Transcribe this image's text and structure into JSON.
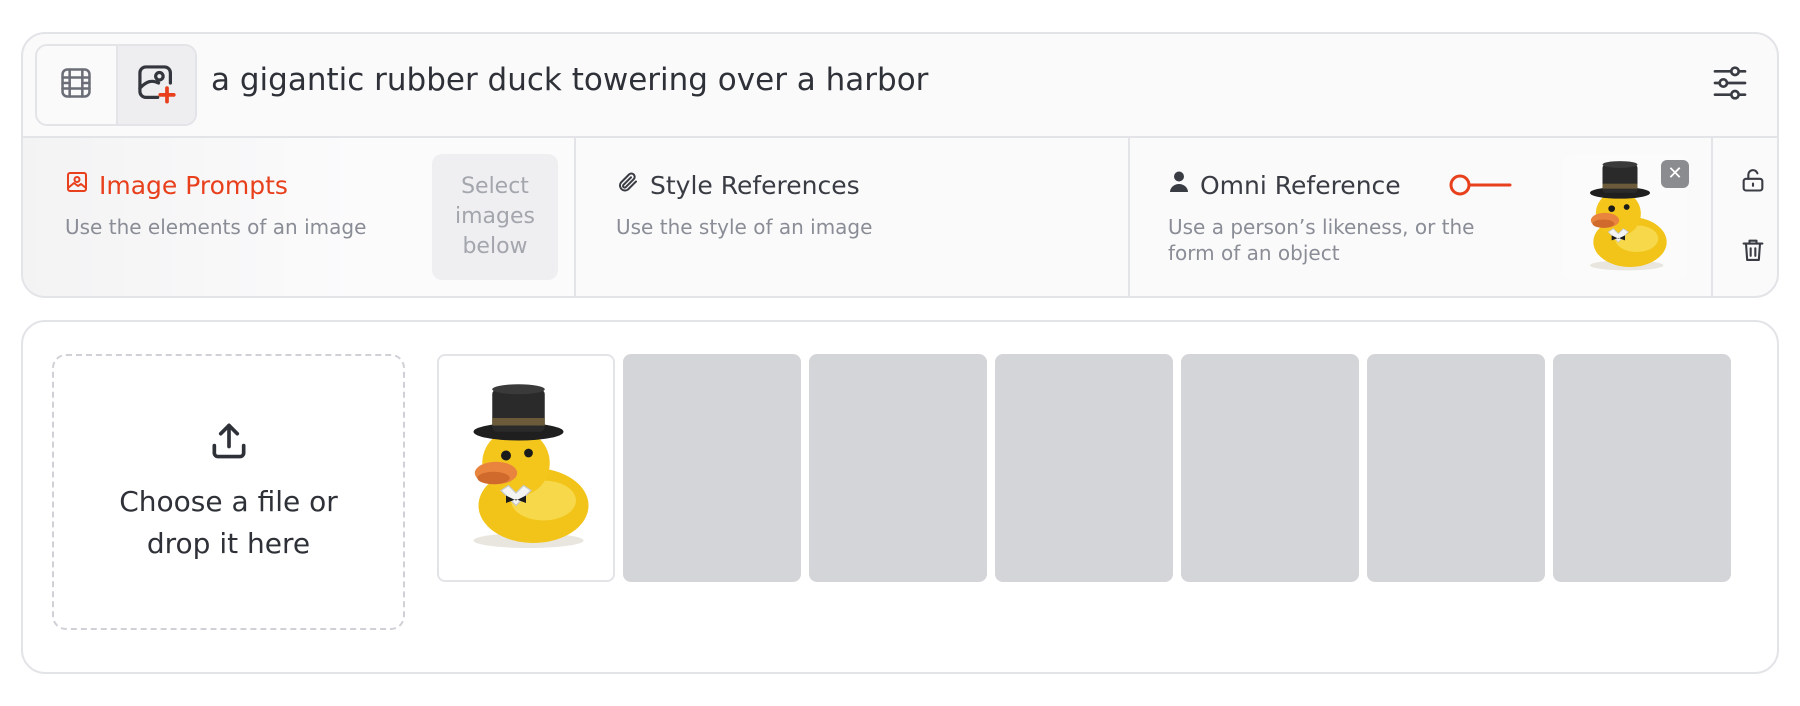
{
  "prompt": {
    "text": "a gigantic rubber duck towering over a harbor",
    "mode_buttons": [
      "film-grid-icon",
      "image-add-icon"
    ],
    "settings_icon": "sliders-icon"
  },
  "references": {
    "image_prompts": {
      "title": "Image Prompts",
      "description": "Use the elements of an image",
      "placeholder": "Select images below",
      "color": "#e8401c"
    },
    "style_references": {
      "title": "Style References",
      "description": "Use the style of an image"
    },
    "omni_reference": {
      "title": "Omni Reference",
      "description": "Use a person’s likeness, or the form of an object",
      "thumbnail": "rubber-duck-with-top-hat",
      "remove_label": "✕"
    }
  },
  "actions": [
    "unlock-icon",
    "trash-icon"
  ],
  "upload": {
    "dropzone_text": "Choose a file or drop it here",
    "tiles": [
      {
        "image": "rubber-duck-with-top-hat"
      },
      {
        "image": ""
      },
      {
        "image": ""
      },
      {
        "image": ""
      },
      {
        "image": ""
      },
      {
        "image": ""
      },
      {
        "image": ""
      }
    ]
  },
  "colors": {
    "accent": "#e8401c",
    "border": "#e3e4e8",
    "placeholder_tile": "#d4d5d8"
  }
}
